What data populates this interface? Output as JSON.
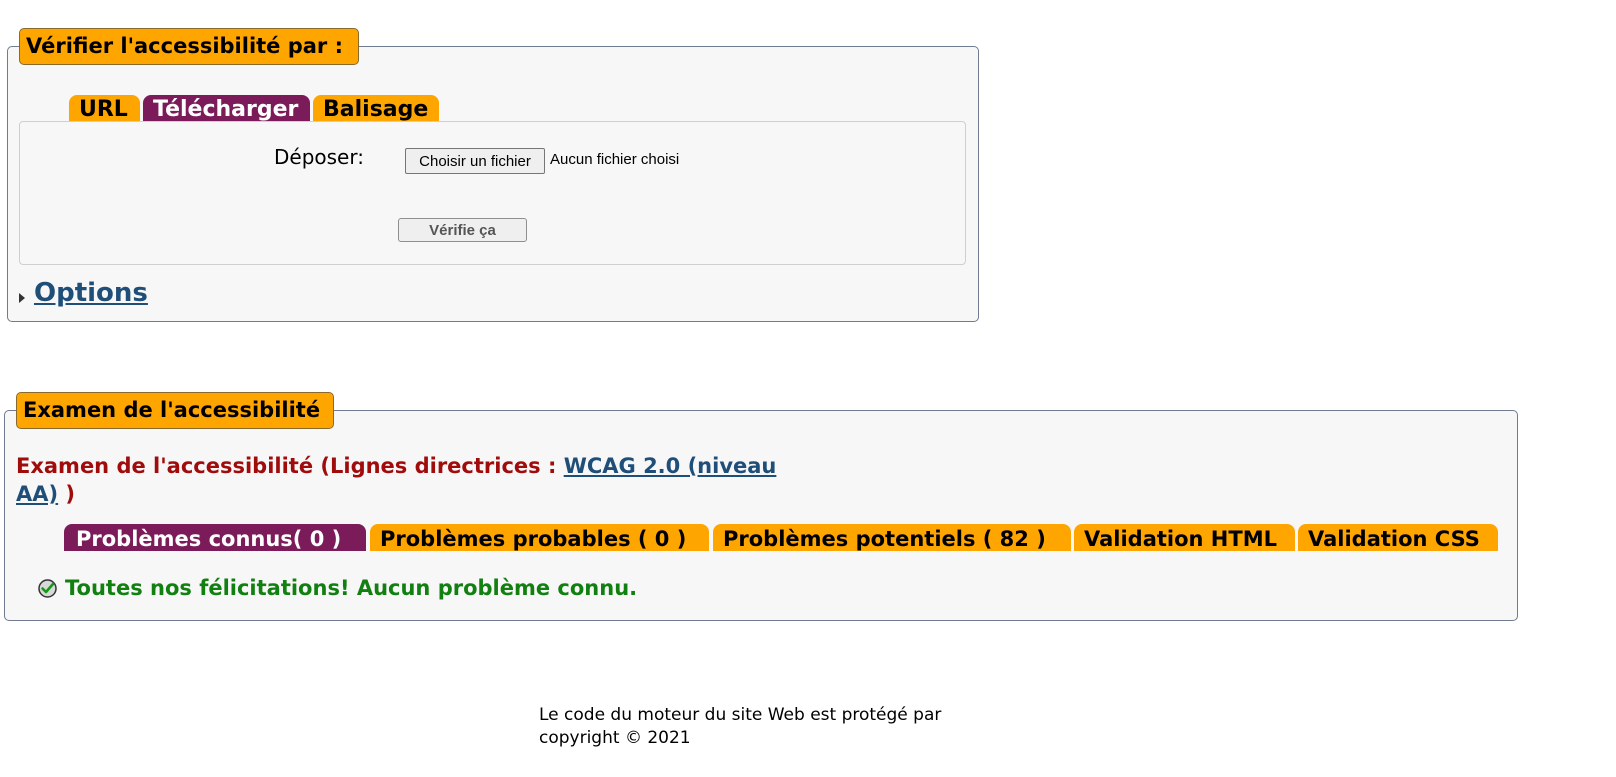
{
  "check_section": {
    "legend": "Vérifier l'accessibilité par :",
    "tabs": [
      {
        "label": "URL",
        "active": false
      },
      {
        "label": "Télécharger",
        "active": true
      },
      {
        "label": "Balisage",
        "active": false
      }
    ],
    "upload_label": "Déposer:",
    "file_button_label": "Choisir un fichier",
    "file_status": "Aucun fichier choisi",
    "submit_label": "Vérifie ça",
    "options_label": "Options"
  },
  "review_section": {
    "legend": "Examen de l'accessibilité",
    "heading_prefix": "Examen de l'accessibilité (Lignes directrices : ",
    "guidelines_link_line1": "WCAG 2.0 (niveau",
    "guidelines_link_line2": "AA)",
    "heading_suffix": " )",
    "tabs": [
      {
        "label": "Problèmes connus( 0 )",
        "active": true
      },
      {
        "label": "Problèmes probables ( 0 )",
        "active": false
      },
      {
        "label": "Problèmes potentiels ( 82 )",
        "active": false
      },
      {
        "label": "Validation HTML",
        "active": false
      },
      {
        "label": "Validation CSS",
        "active": false
      }
    ],
    "success_message": "Toutes nos félicitations! Aucun problème connu."
  },
  "footer": {
    "line1": "Le code du moteur du site Web est protégé par",
    "line2": "copyright © 2021"
  },
  "colors": {
    "tab_orange": "#ffa500",
    "tab_active": "#7b1b5a",
    "heading_red": "#a00c0c",
    "link_blue": "#1f4e79",
    "success_green": "#118011"
  }
}
